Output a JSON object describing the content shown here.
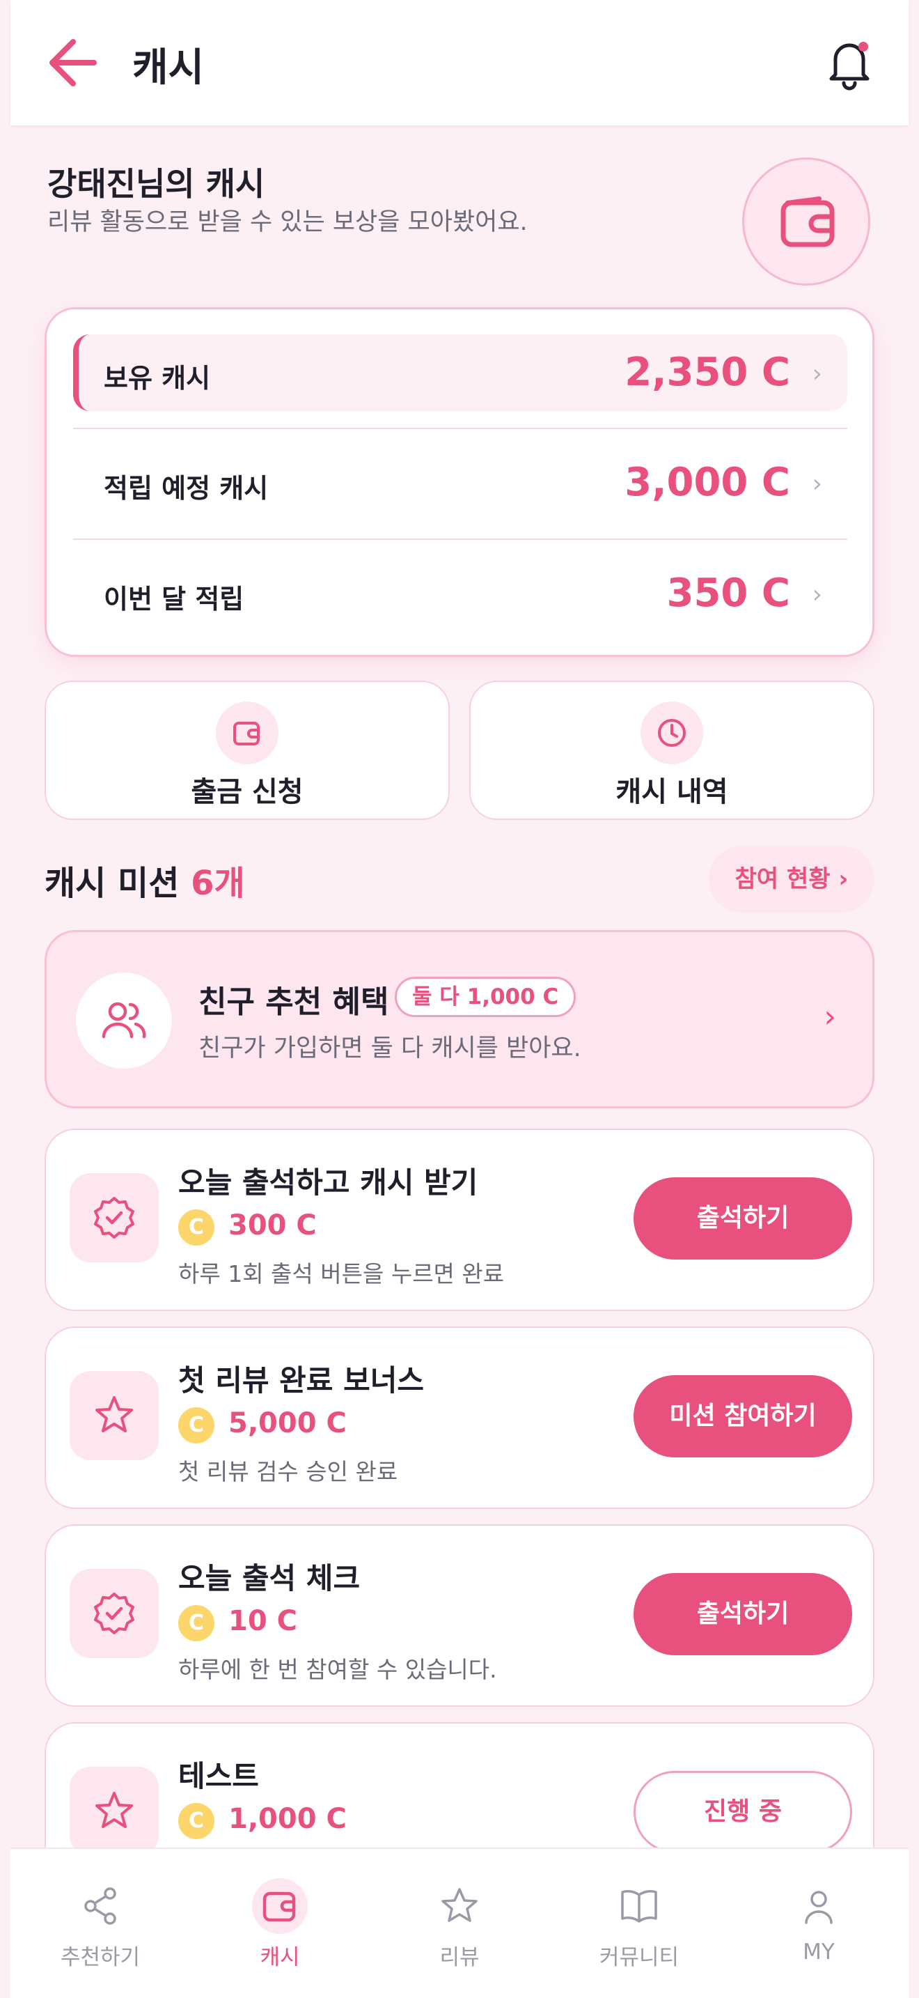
{
  "header": {
    "title": "캐시"
  },
  "user": {
    "name_title": "강태진님의 캐시",
    "subtitle": "리뷰 활동으로 받을 수 있는 보상을 모아봤어요."
  },
  "summary": [
    {
      "label": "보유 캐시",
      "value": "2,350 C"
    },
    {
      "label": "적립 예정 캐시",
      "value": "3,000 C"
    },
    {
      "label": "이번 달 적립",
      "value": "350 C"
    }
  ],
  "quick": {
    "withdraw": "출금 신청",
    "history": "캐시 내역"
  },
  "missions": {
    "title": "캐시 미션",
    "count": "6개",
    "status_link": "참여 현황",
    "referral": {
      "title": "친구 추천 혜택",
      "badge": "둘 다 1,000 C",
      "subtitle": "친구가 가입하면 둘 다 캐시를 받아요."
    },
    "items": [
      {
        "name": "오늘 출석하고 캐시 받기",
        "reward": "300 C",
        "desc": "하루 1회 출석 버튼을 누르면 완료",
        "button": "출석하기",
        "icon": "badge-check-icon"
      },
      {
        "name": "첫 리뷰 완료 보너스",
        "reward": "5,000 C",
        "desc": "첫 리뷰 검수 승인 완료",
        "button": "미션 참여하기",
        "icon": "star-icon"
      },
      {
        "name": "오늘 출석 체크",
        "reward": "10 C",
        "desc": "하루에 한 번 참여할 수 있습니다.",
        "button": "출석하기",
        "icon": "badge-check-icon"
      },
      {
        "name": "테스트",
        "reward": "1,000 C",
        "desc": "",
        "button": "진행 중",
        "icon": "star-icon"
      }
    ],
    "coin_symbol": "C"
  },
  "nav": [
    {
      "label": "추천하기",
      "icon": "share-icon"
    },
    {
      "label": "캐시",
      "icon": "wallet-icon",
      "active": true
    },
    {
      "label": "리뷰",
      "icon": "star-icon"
    },
    {
      "label": "커뮤니티",
      "icon": "book-icon"
    },
    {
      "label": "MY",
      "icon": "user-icon"
    }
  ],
  "colors": {
    "accent": "#e8507e",
    "accent_light": "#fde6ee",
    "background": "#fdf0f4",
    "coin": "#fcd66b"
  }
}
